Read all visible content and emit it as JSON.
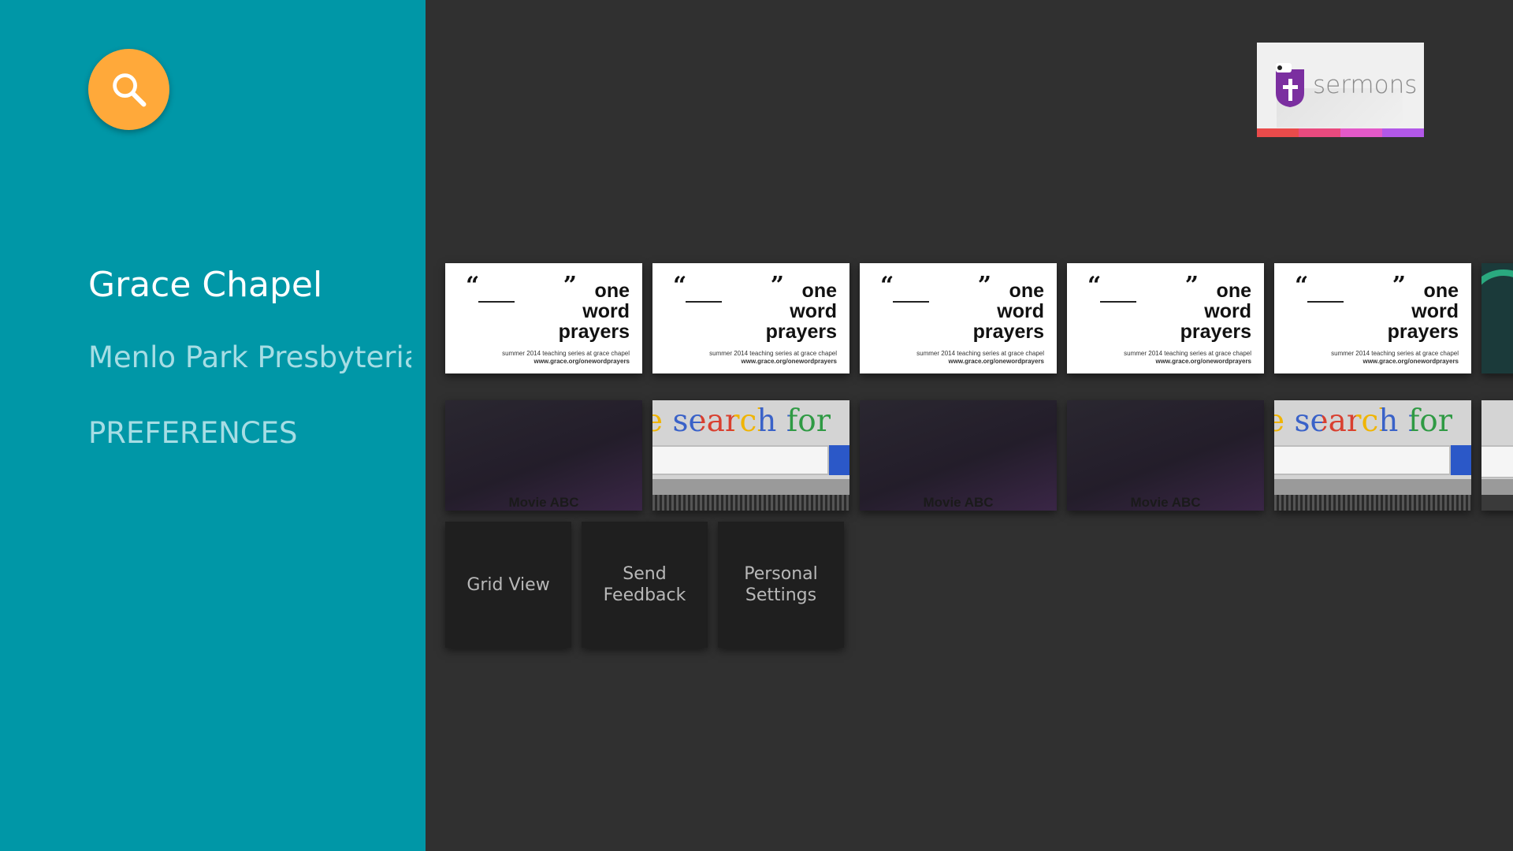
{
  "sidebar": {
    "search_icon": "search-icon",
    "items": [
      {
        "label": "Grace Chapel"
      },
      {
        "label": "Menlo Park Presbyterian Church"
      },
      {
        "label": "PREFERENCES"
      }
    ]
  },
  "brand": {
    "logo_icon": "cross-shield-icon",
    "text": "sermons",
    "colors": [
      "#e94b4b",
      "#e84a7e",
      "#e359c8",
      "#b258e8"
    ]
  },
  "posters": [
    {
      "quotes": "“ ”",
      "title_lines": [
        "one",
        "word",
        "prayers"
      ],
      "line1": "summer 2014 teaching series at grace chapel",
      "line2": "www.grace.org/onewordprayers"
    },
    {
      "quotes": "“ ”",
      "title_lines": [
        "one",
        "word",
        "prayers"
      ],
      "line1": "summer 2014 teaching series at grace chapel",
      "line2": "www.grace.org/onewordprayers"
    },
    {
      "quotes": "“ ”",
      "title_lines": [
        "one",
        "word",
        "prayers"
      ],
      "line1": "summer 2014 teaching series at grace chapel",
      "line2": "www.grace.org/onewordprayers"
    },
    {
      "quotes": "“ ”",
      "title_lines": [
        "one",
        "word",
        "prayers"
      ],
      "line1": "summer 2014 teaching series at grace chapel",
      "line2": "www.grace.org/onewordprayers"
    },
    {
      "quotes": "“ ”",
      "title_lines": [
        "one",
        "word",
        "prayers"
      ],
      "line1": "summer 2014 teaching series at grace chapel",
      "line2": "www.grace.org/onewordprayers"
    }
  ],
  "videos": [
    {
      "kind": "movie",
      "caption": "Movie ABC"
    },
    {
      "kind": "google",
      "caption": "e search for"
    },
    {
      "kind": "movie",
      "caption": "Movie ABC"
    },
    {
      "kind": "movie",
      "caption": "Movie ABC"
    },
    {
      "kind": "google",
      "caption": "e search for"
    }
  ],
  "actions": [
    {
      "label": "Grid View"
    },
    {
      "label": "Send Feedback"
    },
    {
      "label": "Personal Settings"
    }
  ],
  "colors": {
    "sidebar": "#0097a7",
    "search_button": "#ffa93a",
    "background": "#303030"
  }
}
